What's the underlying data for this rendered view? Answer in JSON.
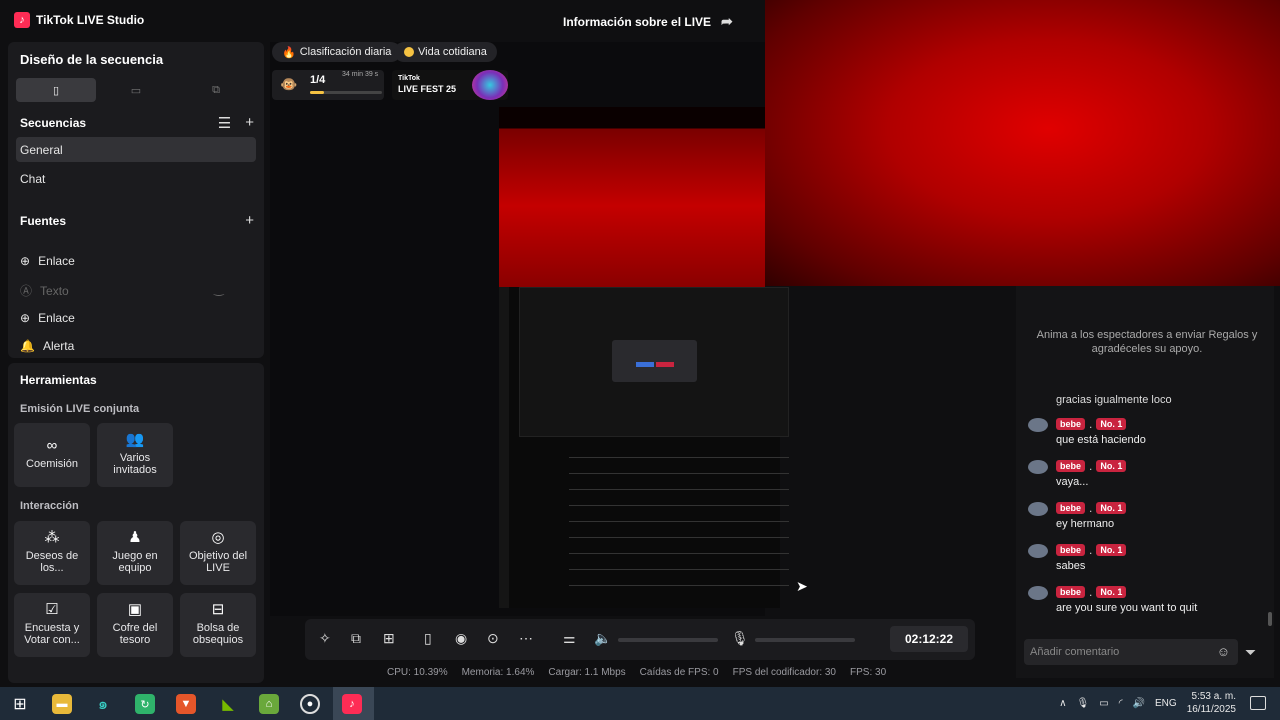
{
  "app": {
    "title": "TikTok LIVE Studio",
    "live_info": "Información sobre el LIVE"
  },
  "scene_panel": {
    "title": "Diseño de la secuencia",
    "sequences_title": "Secuencias",
    "sequences": [
      "General",
      "Chat"
    ],
    "sources_title": "Fuentes",
    "sources": [
      "Enlace",
      "Texto",
      "Enlace",
      "Alerta"
    ]
  },
  "tools_panel": {
    "title": "Herramientas",
    "group1": "Emisión LIVE conjunta",
    "tiles1": [
      "Coemisión",
      "Varios invitados"
    ],
    "group2": "Interacción",
    "tiles2": [
      "Deseos de los...",
      "Juego en equipo",
      "Objetivo del LIVE",
      "Encuesta y Votar con...",
      "Cofre del tesoro",
      "Bolsa de obsequios"
    ]
  },
  "canvas": {
    "pill1": "Clasificación diaria",
    "pill2": "Vida cotidiana",
    "rank": "1/4",
    "rank_time": "34 min 39 s",
    "rank_progress": 0.2,
    "fest_label1": "TikTok",
    "fest_label2": "LIVE FEST 25"
  },
  "chat": {
    "hint": "Anima a los espectadores a enviar Regalos y agradéceles su apoyo.",
    "partial": "gracias igualmente loco",
    "badge_name": "bebe",
    "badge_rank": "No. 1",
    "messages": [
      "que está haciendo",
      "vaya...",
      "ey hermano",
      "sabes",
      "are you sure you want to quit"
    ],
    "comment_placeholder": "Añadir comentario"
  },
  "controls": {
    "timer": "02:12:22"
  },
  "stats": {
    "cpu": "CPU: 10.39%",
    "mem": "Memoria: 1.64%",
    "load": "Cargar: 1.1 Mbps",
    "fps_drop": "Caídas de FPS: 0",
    "enc_fps": "FPS del codificador: 30",
    "fps": "FPS: 30"
  },
  "taskbar": {
    "lang": "ENG",
    "time": "5:53 a. m.",
    "date": "16/11/2025"
  }
}
